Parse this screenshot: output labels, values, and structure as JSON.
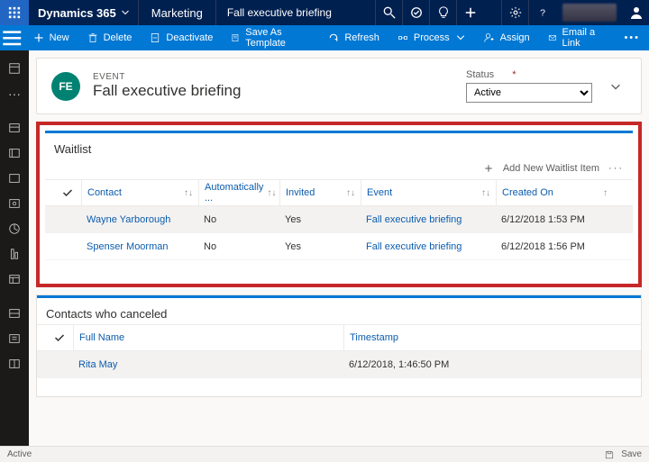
{
  "topbar": {
    "brand": "Dynamics 365",
    "module": "Marketing",
    "crumb": "Fall executive briefing"
  },
  "commands": {
    "new": "New",
    "delete": "Delete",
    "deactivate": "Deactivate",
    "save_as_template": "Save As Template",
    "refresh": "Refresh",
    "process": "Process",
    "assign": "Assign",
    "email_link": "Email a Link"
  },
  "form": {
    "entity_type": "EVENT",
    "title": "Fall executive briefing",
    "avatar_initials": "FE",
    "status_label": "Status",
    "status_value": "Active"
  },
  "waitlist": {
    "title": "Waitlist",
    "add_label": "Add New Waitlist Item",
    "columns": {
      "contact": "Contact",
      "auto": "Automatically ...",
      "invited": "Invited",
      "event": "Event",
      "created": "Created On"
    },
    "rows": [
      {
        "contact": "Wayne Yarborough",
        "auto": "No",
        "invited": "Yes",
        "event": "Fall executive briefing",
        "created": "6/12/2018 1:53 PM"
      },
      {
        "contact": "Spenser Moorman",
        "auto": "No",
        "invited": "Yes",
        "event": "Fall executive briefing",
        "created": "6/12/2018 1:56 PM"
      }
    ]
  },
  "canceled": {
    "title": "Contacts who canceled",
    "columns": {
      "fullname": "Full Name",
      "timestamp": "Timestamp"
    },
    "rows": [
      {
        "fullname": "Rita May",
        "timestamp": "6/12/2018, 1:46:50 PM"
      }
    ]
  },
  "statusbar": {
    "state": "Active",
    "save": "Save"
  }
}
